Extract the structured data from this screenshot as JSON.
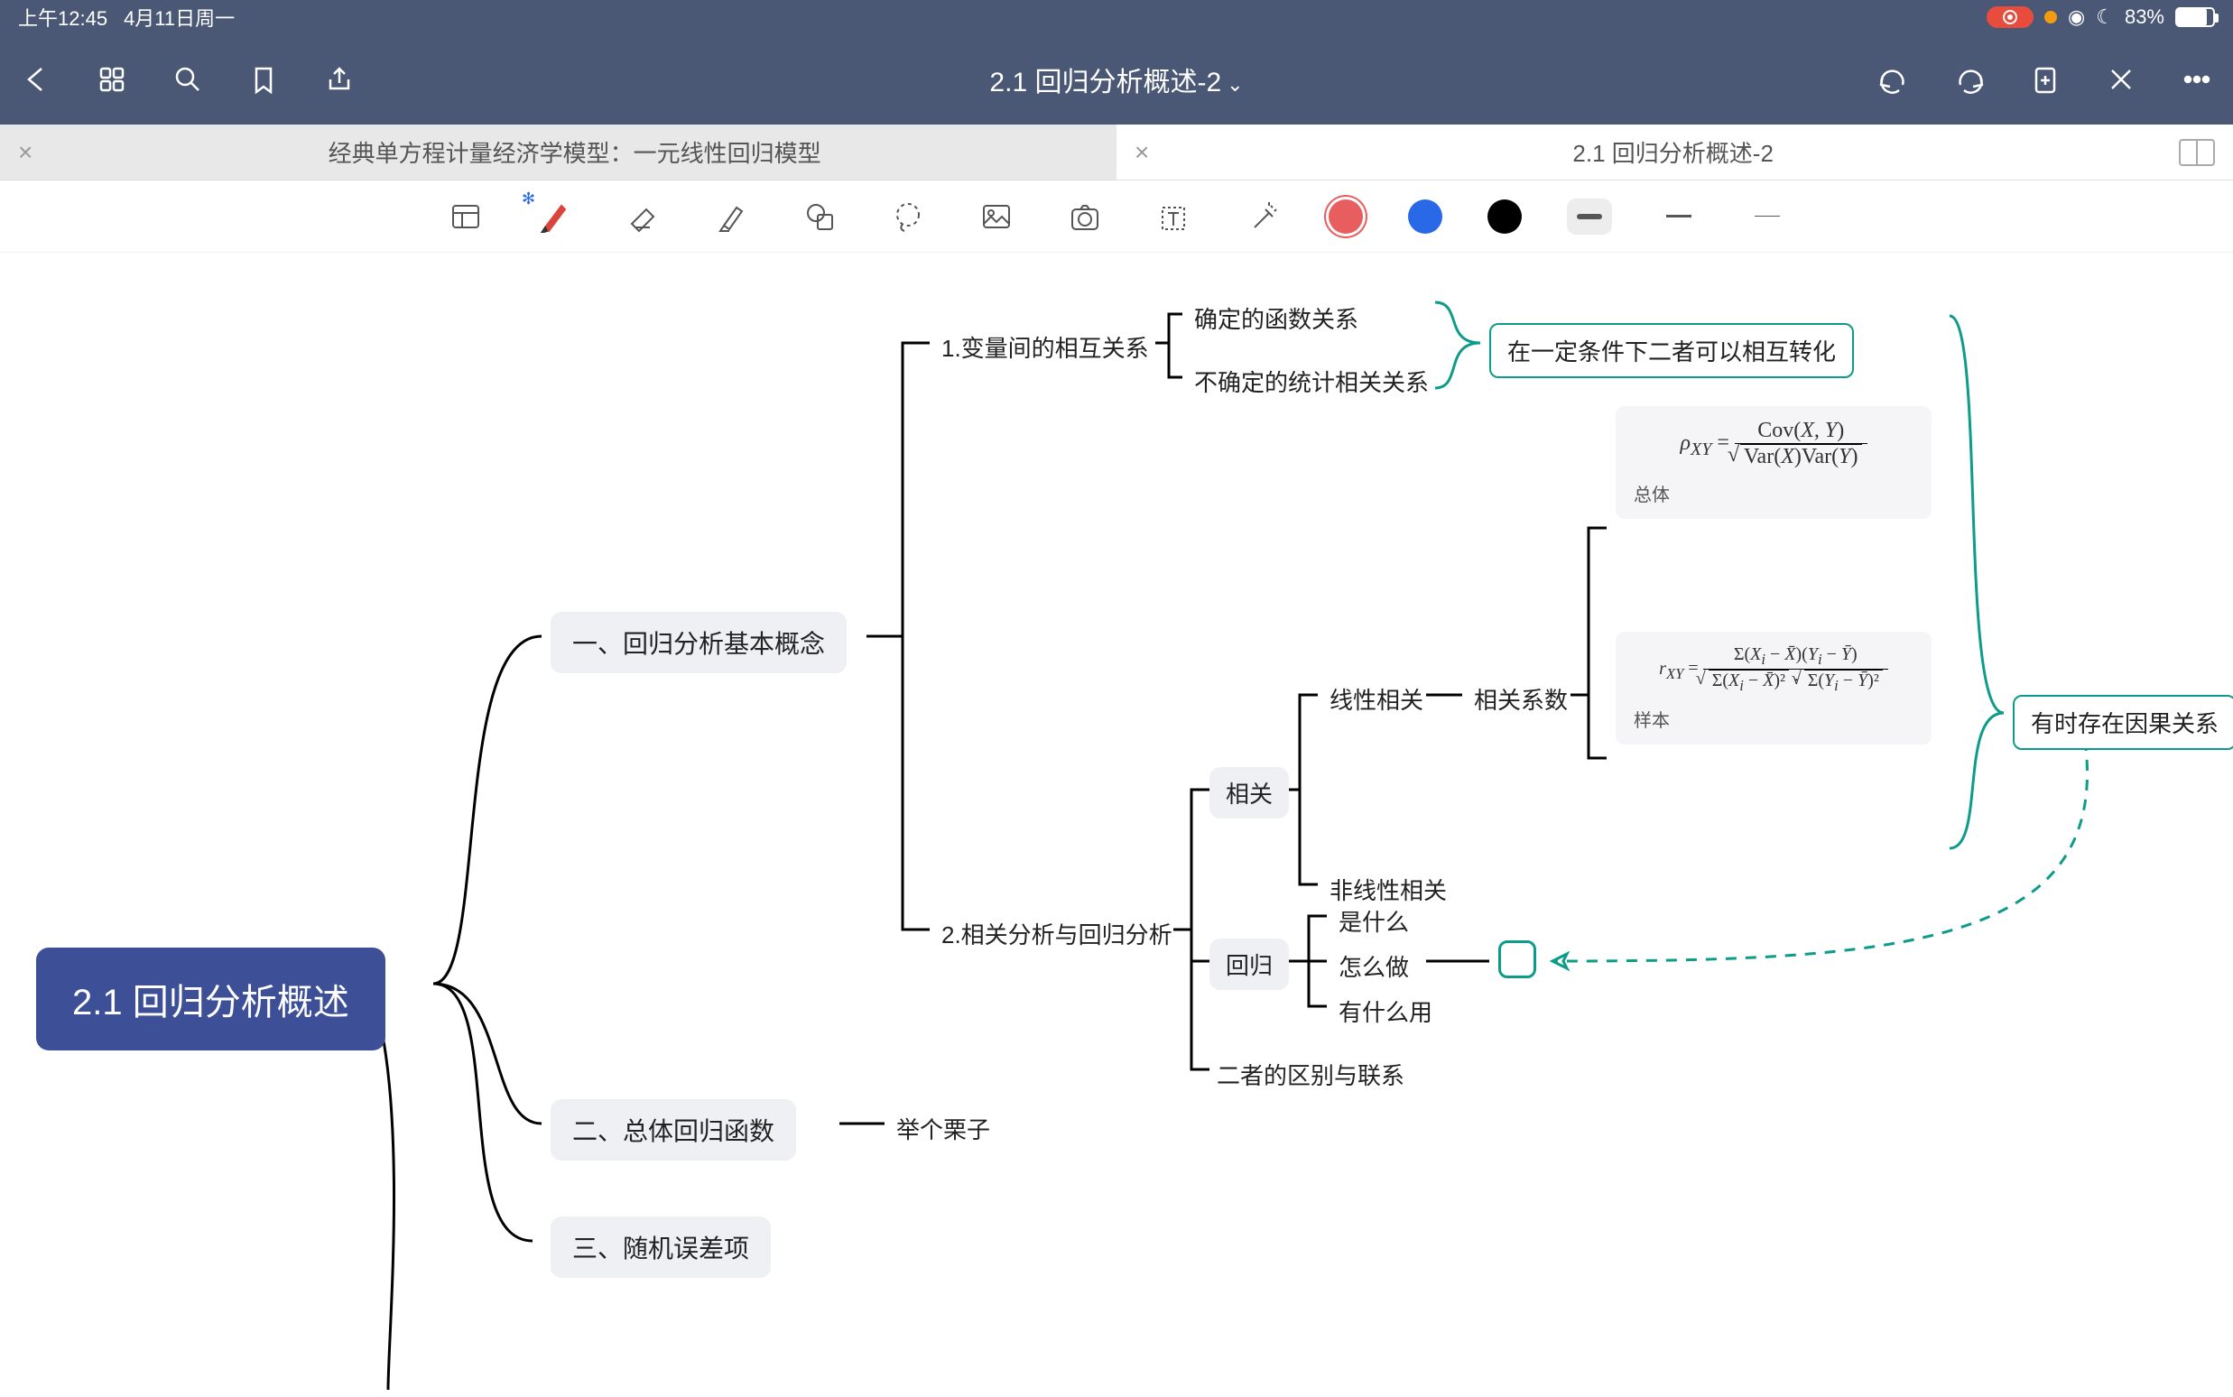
{
  "status": {
    "time": "上午12:45",
    "date": "4月11日周一",
    "battery_pct": "83%",
    "moon": "☾"
  },
  "nav": {
    "title": "2.1 回归分析概述-2"
  },
  "tabs": {
    "inactive_title": "经典单方程计量经济学模型：一元线性回归模型",
    "active_title": "2.1 回归分析概述-2"
  },
  "mindmap": {
    "root": "2.1 回归分析概述",
    "b1": "一、回归分析基本概念",
    "b2": "二、总体回归函数",
    "b3": "三、随机误差项",
    "b1_1": "1.变量间的相互关系",
    "b1_1_a": "确定的函数关系",
    "b1_1_b": "不确定的统计相关关系",
    "b1_1_note": "在一定条件下二者可以相互转化",
    "b1_2": "2.相关分析与回归分析",
    "b1_2_a": "相关",
    "b1_2_a_i": "线性相关",
    "b1_2_a_i_coef": "相关系数",
    "b1_2_a_ii": "非线性相关",
    "b1_2_b": "回归",
    "b1_2_b_i": "是什么",
    "b1_2_b_ii": "怎么做",
    "b1_2_b_iii": "有什么用",
    "b1_2_c": "二者的区别与联系",
    "b2_a": "举个栗子",
    "formula1_label": "总体",
    "formula2_label": "样本",
    "causal_note": "有时存在因果关系"
  }
}
